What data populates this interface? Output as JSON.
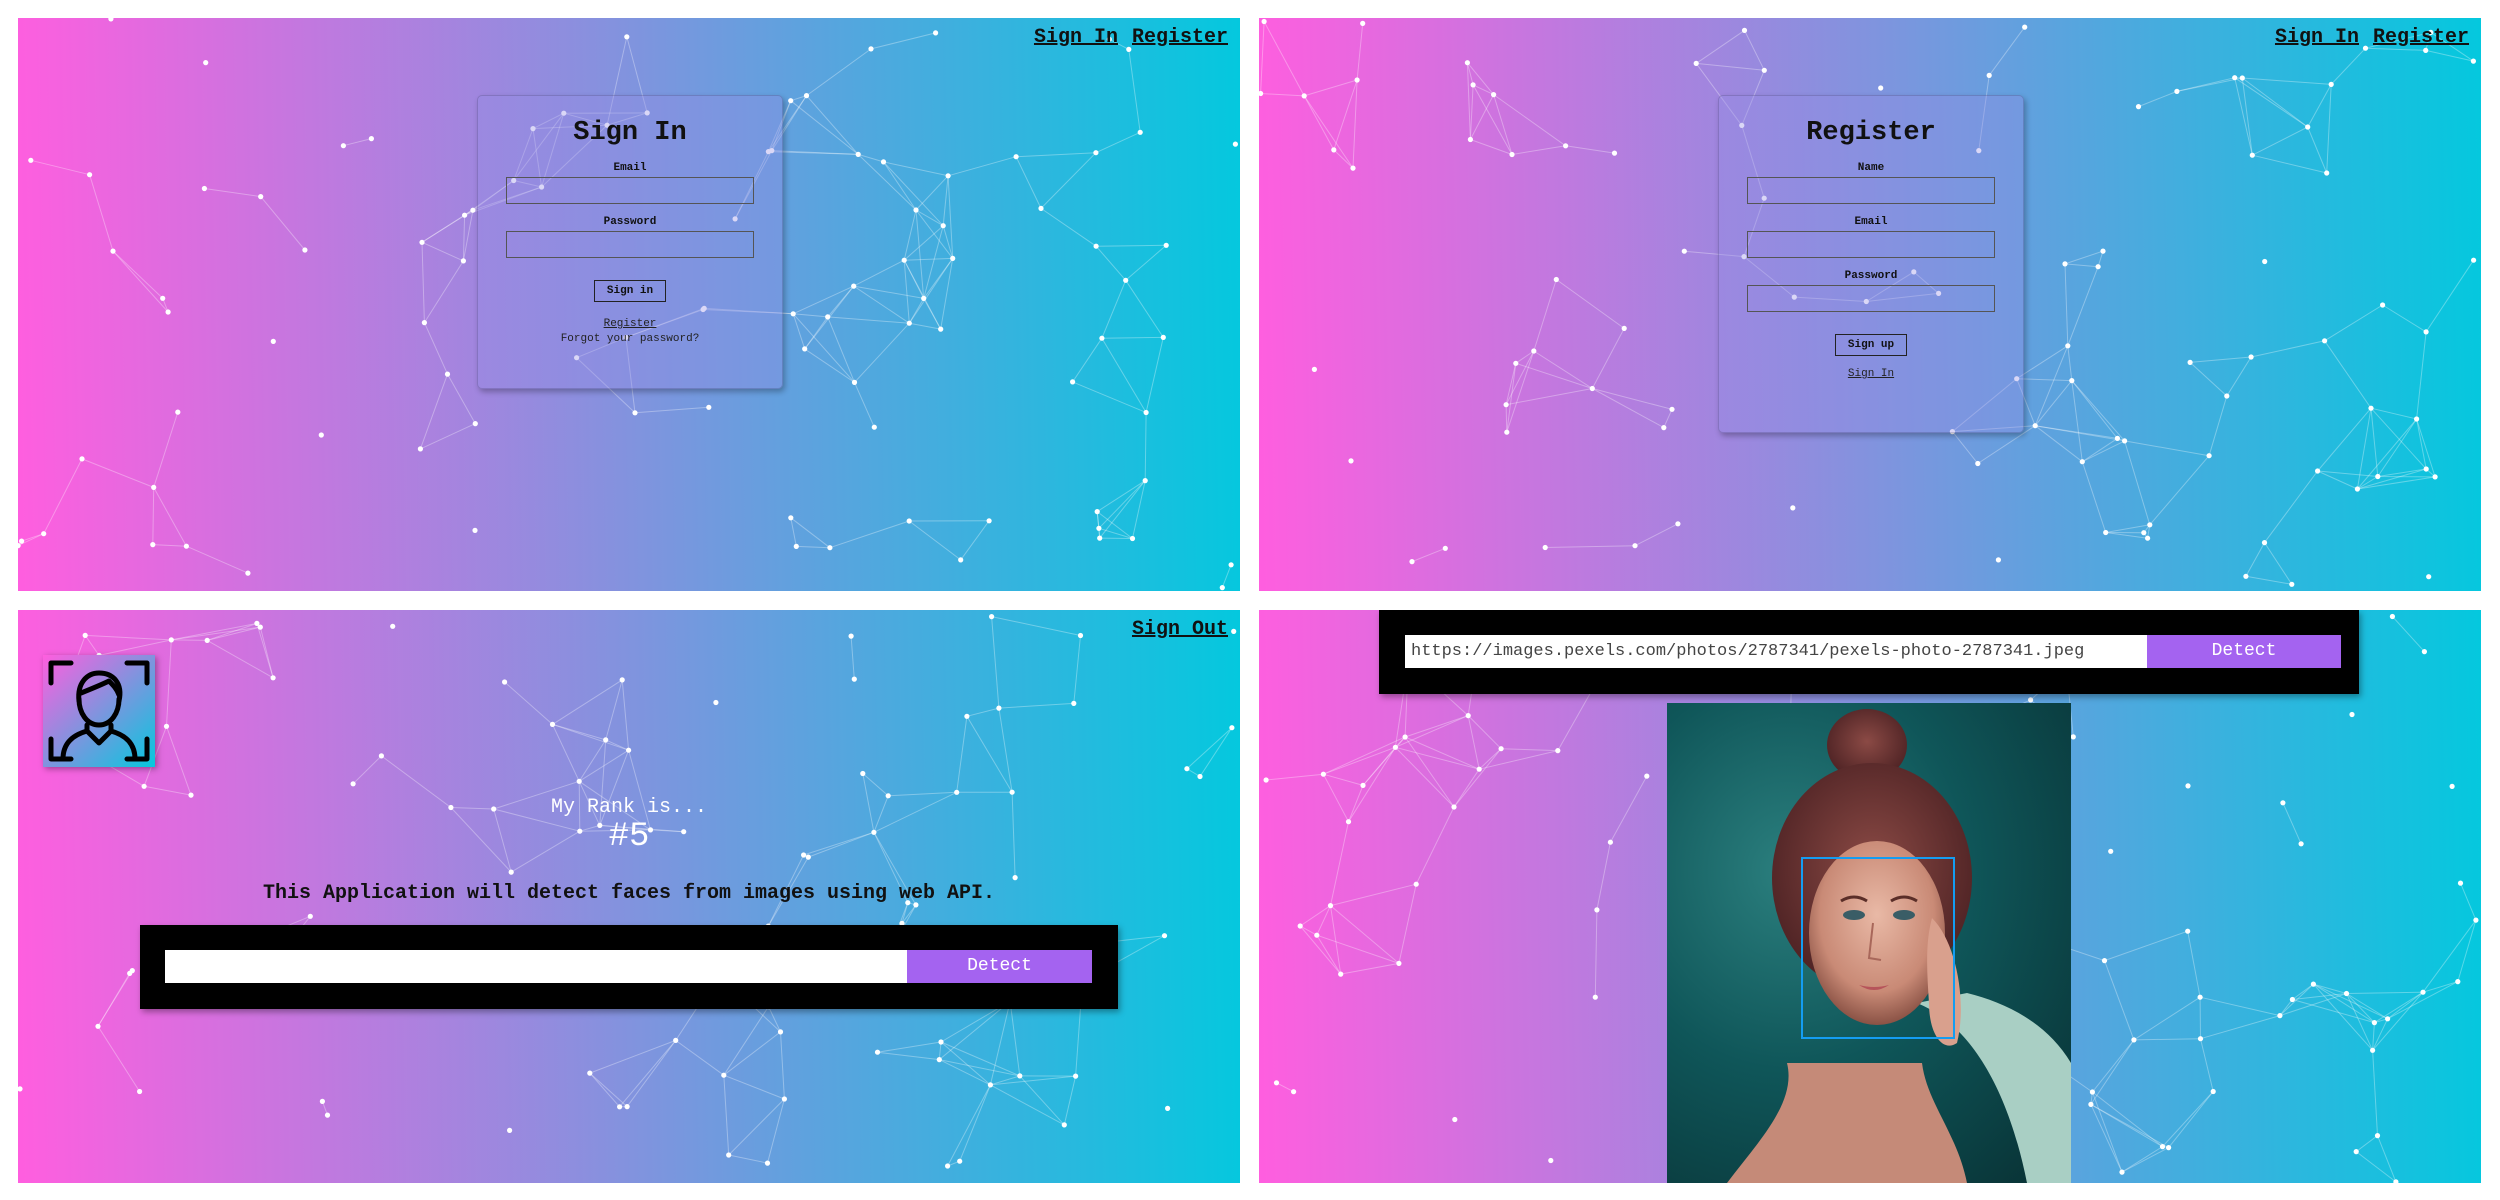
{
  "signin_view": {
    "nav": {
      "signin": "Sign In",
      "register": "Register"
    },
    "form": {
      "title": "Sign In",
      "email_label": "Email",
      "password_label": "Password",
      "submit": "Sign in",
      "register_link": "Register",
      "forgot": "Forgot your password?"
    }
  },
  "register_view": {
    "nav": {
      "signin": "Sign In",
      "register": "Register"
    },
    "form": {
      "title": "Register",
      "name_label": "Name",
      "email_label": "Email",
      "password_label": "Password",
      "submit": "Sign up",
      "signin_link": "Sign In"
    }
  },
  "home_view": {
    "nav": {
      "signout": "Sign Out"
    },
    "logo_icon": "face-scan-icon",
    "rank_label": "My Rank is...",
    "rank_value": "#5",
    "description": "This Application will detect faces from images using web API.",
    "url_value": "",
    "detect": "Detect"
  },
  "result_view": {
    "url_value": "https://images.pexels.com/photos/2787341/pexels-photo-2787341.jpeg",
    "detect": "Detect",
    "image_icon": "woman-portrait-photo",
    "face_box_color": "#149df2"
  },
  "colors": {
    "gradient_start": "#ff5edf",
    "gradient_end": "#04c8de",
    "button": "#a463f0"
  }
}
